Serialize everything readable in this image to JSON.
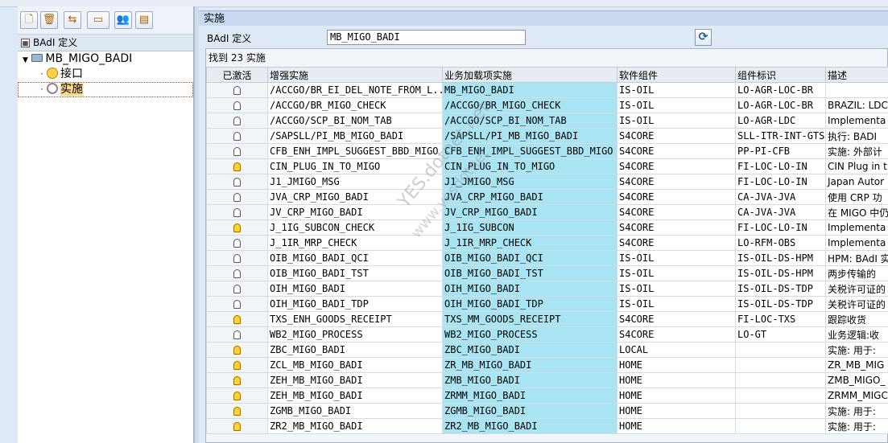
{
  "toolbar": {
    "buttons": [
      {
        "name": "new-icon",
        "glyph": "🗋"
      },
      {
        "name": "delete-icon",
        "glyph": "🗑"
      },
      {
        "name": "transport-icon",
        "glyph": "⇆"
      },
      {
        "name": "settings-icon",
        "glyph": "▭"
      },
      {
        "name": "users-icon",
        "glyph": "👥"
      },
      {
        "name": "docs-icon",
        "glyph": "▤"
      }
    ]
  },
  "tree": {
    "header": "BAdI 定义",
    "root": "MB_MIGO_BADI",
    "children": [
      "接口",
      "实施"
    ]
  },
  "detail": {
    "section_title": "实施",
    "badi_label": "BAdI 定义",
    "badi_value": "MB_MIGO_BADI",
    "found_text": "找到 23 实施"
  },
  "grid": {
    "columns": [
      "已激活",
      "增强实施",
      "业务加载项实施",
      "软件组件",
      "组件标识",
      "描述"
    ],
    "rows": [
      {
        "active": false,
        "impl": "/ACCGO/BR_EI_DEL_NOTE_FROM_L...",
        "badi_impl": "MB_MIGO_BADI",
        "comp": "IS-OIL",
        "comp_id": "LO-AGR-LOC-BR",
        "desc": ""
      },
      {
        "active": false,
        "impl": "/ACCGO/BR_MIGO_CHECK",
        "badi_impl": "/ACCGO/BR_MIGO_CHECK",
        "comp": "IS-OIL",
        "comp_id": "LO-AGR-LOC-BR",
        "desc": "BRAZIL: LDC"
      },
      {
        "active": false,
        "impl": "/ACCGO/SCP_BI_NOM_TAB",
        "badi_impl": "/ACCGO/SCP_BI_NOM_TAB",
        "comp": "IS-OIL",
        "comp_id": "LO-AGR-LDC",
        "desc": "Implementa"
      },
      {
        "active": false,
        "impl": "/SAPSLL/PI_MB_MIGO_BADI",
        "badi_impl": "/SAPSLL/PI_MB_MIGO_BADI",
        "comp": "S4CORE",
        "comp_id": "SLL-ITR-INT-GTS",
        "desc": "执行: BADI"
      },
      {
        "active": false,
        "impl": "CFB_ENH_IMPL_SUGGEST_BBD_MIGO",
        "badi_impl": "CFB_ENH_IMPL_SUGGEST_BBD_MIGO",
        "comp": "S4CORE",
        "comp_id": "PP-PI-CFB",
        "desc": "实施: 外部计"
      },
      {
        "active": true,
        "impl": "CIN_PLUG_IN_TO_MIGO",
        "badi_impl": "CIN_PLUG_IN_TO_MIGO",
        "comp": "S4CORE",
        "comp_id": "FI-LOC-LO-IN",
        "desc": "CIN Plug in t"
      },
      {
        "active": false,
        "impl": "J1_JMIGO_MSG",
        "badi_impl": "J1_JMIGO_MSG",
        "comp": "S4CORE",
        "comp_id": "FI-LOC-LO-IN",
        "desc": "Japan Autor"
      },
      {
        "active": false,
        "impl": "JVA_CRP_MIGO_BADI",
        "badi_impl": "JVA_CRP_MIGO_BADI",
        "comp": "S4CORE",
        "comp_id": "CA-JVA-JVA",
        "desc": "使用 CRP 功"
      },
      {
        "active": false,
        "impl": "JV_CRP_MIGO_BADI",
        "badi_impl": "JV_CRP_MIGO_BADI",
        "comp": "S4CORE",
        "comp_id": "CA-JVA-JVA",
        "desc": "在 MIGO 中仍"
      },
      {
        "active": true,
        "impl": "J_1IG_SUBCON_CHECK",
        "badi_impl": "J_1IG_SUBCON",
        "comp": "S4CORE",
        "comp_id": "FI-LOC-LO-IN",
        "desc": "Implementa"
      },
      {
        "active": false,
        "impl": "J_1IR_MRP_CHECK",
        "badi_impl": "J_1IR_MRP_CHECK",
        "comp": "S4CORE",
        "comp_id": "LO-RFM-OBS",
        "desc": "Implementa"
      },
      {
        "active": false,
        "impl": "OIB_MIGO_BADI_QCI",
        "badi_impl": "OIB_MIGO_BADI_QCI",
        "comp": "IS-OIL",
        "comp_id": "IS-OIL-DS-HPM",
        "desc": "HPM: BAdI 实"
      },
      {
        "active": false,
        "impl": "OIB_MIGO_BADI_TST",
        "badi_impl": "OIB_MIGO_BADI_TST",
        "comp": "IS-OIL",
        "comp_id": "IS-OIL-DS-HPM",
        "desc": "两步传输的"
      },
      {
        "active": false,
        "impl": "OIH_MIGO_BADI",
        "badi_impl": "OIH_MIGO_BADI",
        "comp": "IS-OIL",
        "comp_id": "IS-OIL-DS-TDP",
        "desc": "关税许可证的"
      },
      {
        "active": false,
        "impl": "OIH_MIGO_BADI_TDP",
        "badi_impl": "OIH_MIGO_BADI_TDP",
        "comp": "IS-OIL",
        "comp_id": "IS-OIL-DS-TDP",
        "desc": "关税许可证的"
      },
      {
        "active": true,
        "impl": "TXS_ENH_GOODS_RECEIPT",
        "badi_impl": "TXS_MM_GOODS_RECEIPT",
        "comp": "S4CORE",
        "comp_id": "FI-LOC-TXS",
        "desc": "跟踪收货"
      },
      {
        "active": false,
        "impl": "WB2_MIGO_PROCESS",
        "badi_impl": "WB2_MIGO_PROCESS",
        "comp": "S4CORE",
        "comp_id": "LO-GT",
        "desc": "业务逻辑:收"
      },
      {
        "active": true,
        "impl": "ZBC_MIGO_BADI",
        "badi_impl": "ZBC_MIGO_BADI",
        "comp": "LOCAL",
        "comp_id": "",
        "desc": "实施: 用于:"
      },
      {
        "active": true,
        "impl": "ZCL_MB_MIGO_BADI",
        "badi_impl": "ZR_MB_MIGO_BADI",
        "comp": "HOME",
        "comp_id": "",
        "desc": "ZR_MB_MIG"
      },
      {
        "active": true,
        "impl": "ZEH_MB_MIGO_BADI",
        "badi_impl": "ZMB_MIGO_BADI",
        "comp": "HOME",
        "comp_id": "",
        "desc": "ZMB_MIGO_"
      },
      {
        "active": true,
        "impl": "ZEH_MB_MIGO_BADI",
        "badi_impl": "ZRMM_MIGO_BADI",
        "comp": "HOME",
        "comp_id": "",
        "desc": "ZRMM_MIGC"
      },
      {
        "active": true,
        "impl": "ZGMB_MIGO_BADI",
        "badi_impl": "ZGMB_MIGO_BADI",
        "comp": "HOME",
        "comp_id": "",
        "desc": "实施: 用于:"
      },
      {
        "active": true,
        "impl": "ZR2_MB_MIGO_BADI",
        "badi_impl": "ZR2_MB_MIGO_BADI",
        "comp": "HOME",
        "comp_id": "",
        "desc": "实施: 用于:"
      }
    ]
  },
  "watermark": {
    "line1": "YES.dotnet.net",
    "line2": "www.yesdotnet"
  }
}
